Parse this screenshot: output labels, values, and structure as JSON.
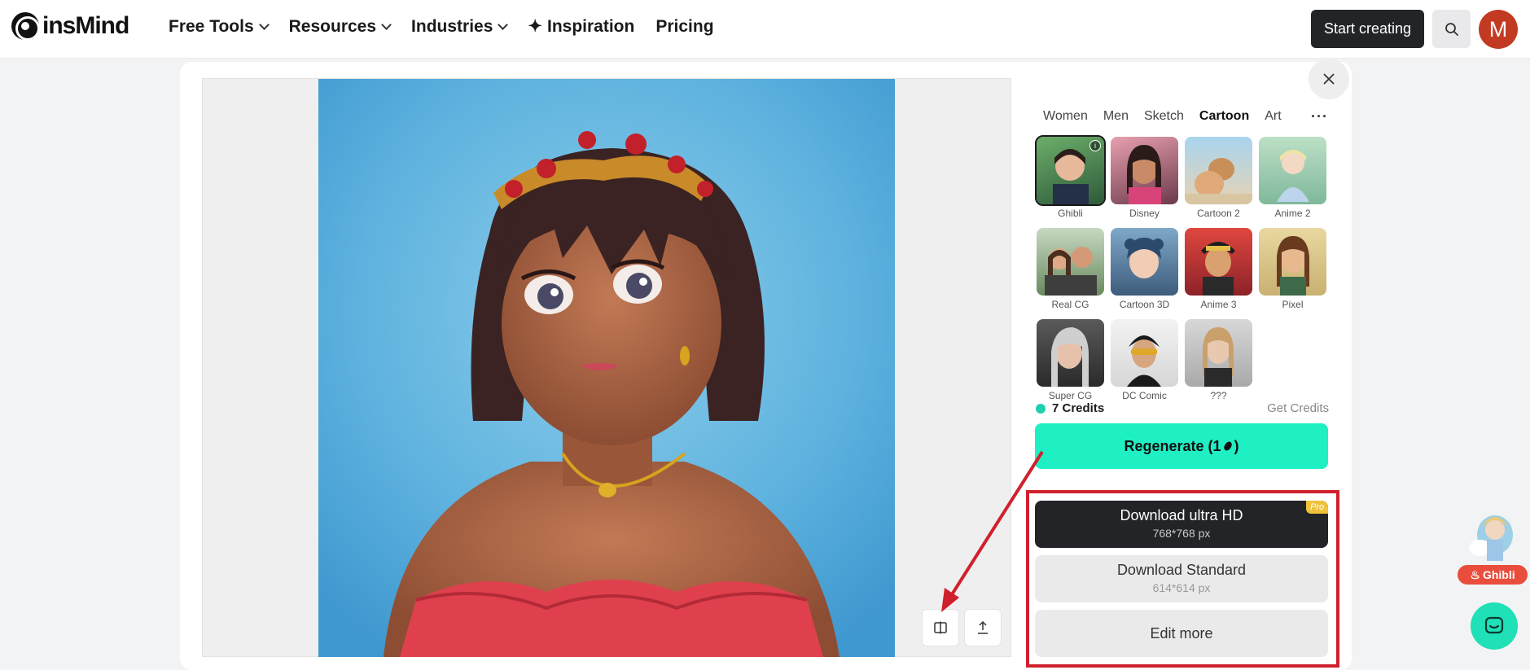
{
  "nav": {
    "logo": "insMind",
    "items": [
      {
        "label": "Free Tools",
        "dropdown": true
      },
      {
        "label": "Resources",
        "dropdown": true
      },
      {
        "label": "Industries",
        "dropdown": true
      },
      {
        "label": "Inspiration",
        "dropdown": false
      },
      {
        "label": "Pricing",
        "dropdown": false
      }
    ],
    "start_button": "Start creating",
    "avatar_initial": "M"
  },
  "panel": {
    "tabs": [
      "Women",
      "Men",
      "Sketch",
      "Cartoon",
      "Art"
    ],
    "active_tab": "Cartoon",
    "styles": [
      "Ghibli",
      "Disney",
      "Cartoon 2",
      "Anime 2",
      "Real CG",
      "Cartoon 3D",
      "Anime 3",
      "Pixel",
      "Super CG",
      "DC Comic",
      "???"
    ],
    "selected_style": "Ghibli",
    "credits": "7 Credits",
    "get_credits": "Get Credits",
    "regenerate": "Regenerate (1",
    "regenerate_suffix": ")",
    "download_hd": {
      "label": "Download ultra HD",
      "size": "768*768 px",
      "badge": "Pro"
    },
    "download_standard": {
      "label": "Download Standard",
      "size": "614*614 px"
    },
    "edit_more": "Edit more"
  },
  "float": {
    "ghibli_badge": "Ghibli"
  },
  "colors": {
    "accent": "#1ff0c4",
    "dark": "#222427",
    "annotation": "#d0202e",
    "avatar": "#c23a22"
  }
}
